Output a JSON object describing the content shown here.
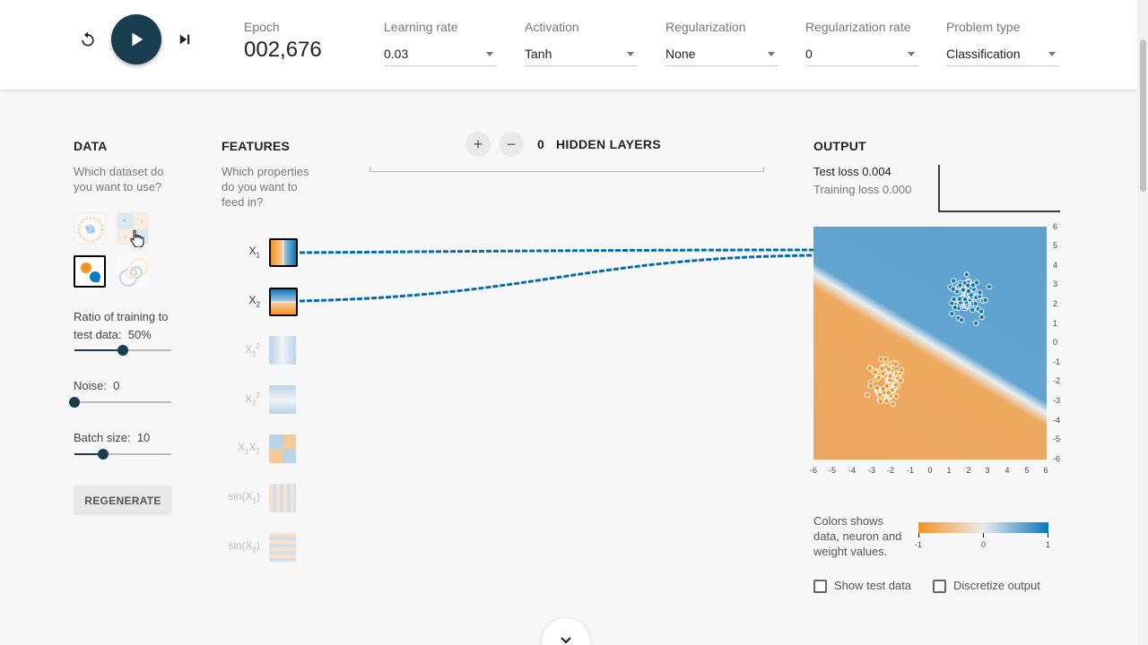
{
  "header": {
    "epoch_label": "Epoch",
    "epoch_value": "002,676",
    "controls": [
      {
        "label": "Learning rate",
        "value": "0.03"
      },
      {
        "label": "Activation",
        "value": "Tanh"
      },
      {
        "label": "Regularization",
        "value": "None"
      },
      {
        "label": "Regularization rate",
        "value": "0"
      },
      {
        "label": "Problem type",
        "value": "Classification"
      }
    ]
  },
  "data_panel": {
    "title": "DATA",
    "subtitle_line1": "Which dataset do",
    "subtitle_line2": "you want to use?",
    "selected_dataset": "gaussian",
    "ratio_label_line1": "Ratio of training to",
    "ratio_label_line2": "test data:",
    "ratio_value": "50%",
    "noise_label": "Noise:",
    "noise_value": "0",
    "batch_label": "Batch size:",
    "batch_value": "10",
    "ratio_fraction": 0.5,
    "noise_fraction": 0.0,
    "batch_fraction": 0.3,
    "regenerate_label": "REGENERATE"
  },
  "features_panel": {
    "title": "FEATURES",
    "subtitle_line1": "Which properties",
    "subtitle_line2": "do you want to",
    "subtitle_line3": "feed in?",
    "features": [
      {
        "name": "X1",
        "active": true
      },
      {
        "name": "X2",
        "active": true
      },
      {
        "name": "X1^2",
        "active": false
      },
      {
        "name": "X2^2",
        "active": false
      },
      {
        "name": "X1X2",
        "active": false
      },
      {
        "name": "sin(X1)",
        "active": false
      },
      {
        "name": "sin(X2)",
        "active": false
      }
    ]
  },
  "network": {
    "hidden_layer_count": "0",
    "hidden_layers_label": "HIDDEN LAYERS",
    "add_label": "+",
    "remove_label": "−"
  },
  "output_panel": {
    "title": "OUTPUT",
    "test_loss_label": "Test loss",
    "test_loss_value": "0.004",
    "training_loss_label": "Training loss",
    "training_loss_value": "0.000",
    "y_ticks": [
      "6",
      "5",
      "4",
      "3",
      "2",
      "1",
      "0",
      "-1",
      "-2",
      "-3",
      "-4",
      "-5",
      "-6"
    ],
    "x_ticks": [
      "-6",
      "-5",
      "-4",
      "-3",
      "-2",
      "-1",
      "0",
      "1",
      "2",
      "3",
      "4",
      "5",
      "6"
    ],
    "legend_line1": "Colors shows",
    "legend_line2": "data, neuron and",
    "legend_line3": "weight values.",
    "legend_min": "-1",
    "legend_mid": "0",
    "legend_max": "1",
    "show_test_label": "Show test data",
    "discretize_label": "Discretize output"
  },
  "colors": {
    "orange": "#f59322",
    "blue": "#0877bd",
    "dark_button": "#183d4e"
  }
}
